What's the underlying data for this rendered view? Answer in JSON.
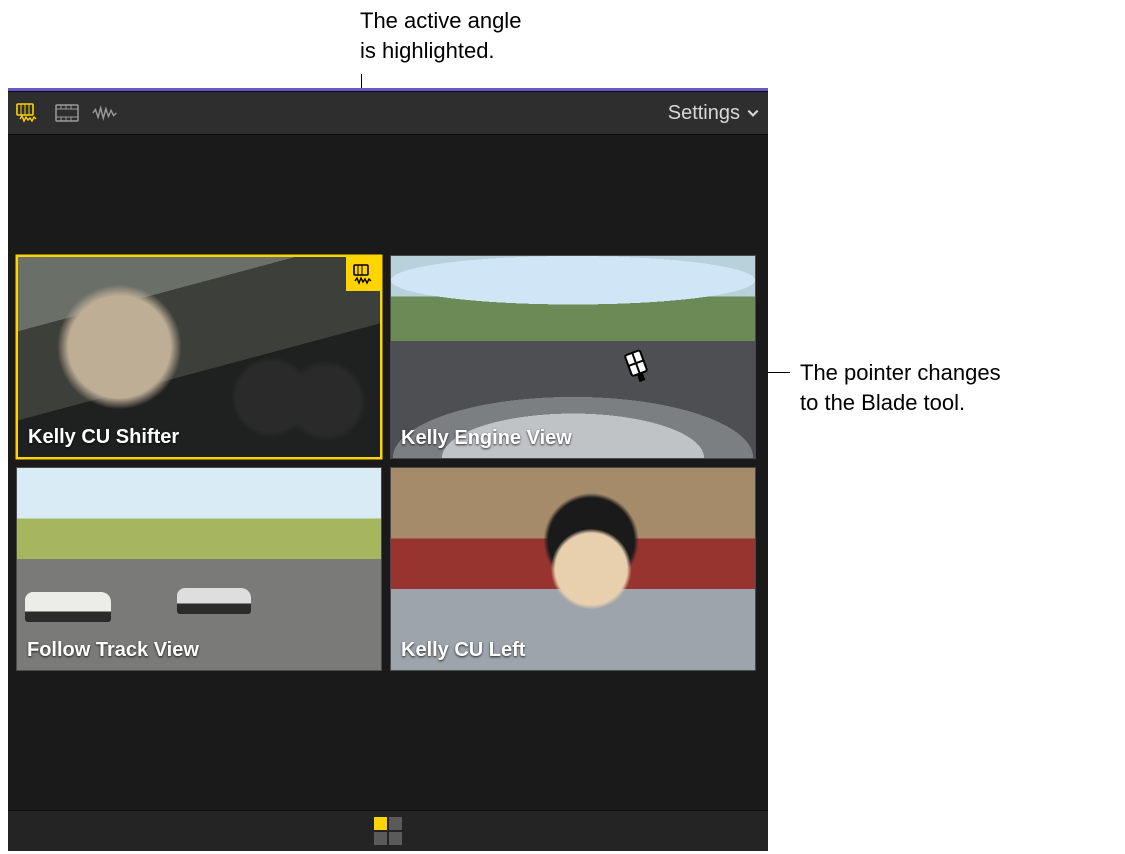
{
  "annotations": {
    "active": "The active angle\nis highlighted.",
    "blade": "The pointer changes\nto the Blade tool."
  },
  "toolbar": {
    "settings_label": "Settings"
  },
  "angles": [
    {
      "label": "Kelly CU Shifter",
      "active": true
    },
    {
      "label": "Kelly Engine View",
      "active": false
    },
    {
      "label": "Follow Track View",
      "active": false
    },
    {
      "label": "Kelly CU Left",
      "active": false
    }
  ],
  "colors": {
    "accent": "#ffd400",
    "window_bg": "#1a1a1a",
    "toolbar_bg": "#2e2e2e"
  }
}
